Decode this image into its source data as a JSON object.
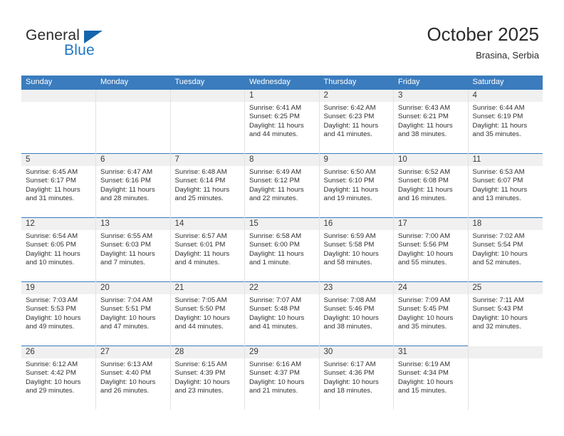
{
  "logo": {
    "word_top": "General",
    "word_bottom": "Blue",
    "triangle_color": "#1565ad",
    "blue_color": "#1f77c4"
  },
  "header": {
    "title": "October 2025",
    "subtitle": "Brasina, Serbia"
  },
  "theme": {
    "header_blue": "#3a7cbe",
    "daynum_band": "#f0f0f0",
    "cell_border": "#e2e2e2"
  },
  "weekdays": [
    "Sunday",
    "Monday",
    "Tuesday",
    "Wednesday",
    "Thursday",
    "Friday",
    "Saturday"
  ],
  "weeks": [
    [
      {
        "day": ""
      },
      {
        "day": ""
      },
      {
        "day": ""
      },
      {
        "day": "1",
        "sunrise": "Sunrise: 6:41 AM",
        "sunset": "Sunset: 6:25 PM",
        "daylight": "Daylight: 11 hours and 44 minutes."
      },
      {
        "day": "2",
        "sunrise": "Sunrise: 6:42 AM",
        "sunset": "Sunset: 6:23 PM",
        "daylight": "Daylight: 11 hours and 41 minutes."
      },
      {
        "day": "3",
        "sunrise": "Sunrise: 6:43 AM",
        "sunset": "Sunset: 6:21 PM",
        "daylight": "Daylight: 11 hours and 38 minutes."
      },
      {
        "day": "4",
        "sunrise": "Sunrise: 6:44 AM",
        "sunset": "Sunset: 6:19 PM",
        "daylight": "Daylight: 11 hours and 35 minutes."
      }
    ],
    [
      {
        "day": "5",
        "sunrise": "Sunrise: 6:45 AM",
        "sunset": "Sunset: 6:17 PM",
        "daylight": "Daylight: 11 hours and 31 minutes."
      },
      {
        "day": "6",
        "sunrise": "Sunrise: 6:47 AM",
        "sunset": "Sunset: 6:16 PM",
        "daylight": "Daylight: 11 hours and 28 minutes."
      },
      {
        "day": "7",
        "sunrise": "Sunrise: 6:48 AM",
        "sunset": "Sunset: 6:14 PM",
        "daylight": "Daylight: 11 hours and 25 minutes."
      },
      {
        "day": "8",
        "sunrise": "Sunrise: 6:49 AM",
        "sunset": "Sunset: 6:12 PM",
        "daylight": "Daylight: 11 hours and 22 minutes."
      },
      {
        "day": "9",
        "sunrise": "Sunrise: 6:50 AM",
        "sunset": "Sunset: 6:10 PM",
        "daylight": "Daylight: 11 hours and 19 minutes."
      },
      {
        "day": "10",
        "sunrise": "Sunrise: 6:52 AM",
        "sunset": "Sunset: 6:08 PM",
        "daylight": "Daylight: 11 hours and 16 minutes."
      },
      {
        "day": "11",
        "sunrise": "Sunrise: 6:53 AM",
        "sunset": "Sunset: 6:07 PM",
        "daylight": "Daylight: 11 hours and 13 minutes."
      }
    ],
    [
      {
        "day": "12",
        "sunrise": "Sunrise: 6:54 AM",
        "sunset": "Sunset: 6:05 PM",
        "daylight": "Daylight: 11 hours and 10 minutes."
      },
      {
        "day": "13",
        "sunrise": "Sunrise: 6:55 AM",
        "sunset": "Sunset: 6:03 PM",
        "daylight": "Daylight: 11 hours and 7 minutes."
      },
      {
        "day": "14",
        "sunrise": "Sunrise: 6:57 AM",
        "sunset": "Sunset: 6:01 PM",
        "daylight": "Daylight: 11 hours and 4 minutes."
      },
      {
        "day": "15",
        "sunrise": "Sunrise: 6:58 AM",
        "sunset": "Sunset: 6:00 PM",
        "daylight": "Daylight: 11 hours and 1 minute."
      },
      {
        "day": "16",
        "sunrise": "Sunrise: 6:59 AM",
        "sunset": "Sunset: 5:58 PM",
        "daylight": "Daylight: 10 hours and 58 minutes."
      },
      {
        "day": "17",
        "sunrise": "Sunrise: 7:00 AM",
        "sunset": "Sunset: 5:56 PM",
        "daylight": "Daylight: 10 hours and 55 minutes."
      },
      {
        "day": "18",
        "sunrise": "Sunrise: 7:02 AM",
        "sunset": "Sunset: 5:54 PM",
        "daylight": "Daylight: 10 hours and 52 minutes."
      }
    ],
    [
      {
        "day": "19",
        "sunrise": "Sunrise: 7:03 AM",
        "sunset": "Sunset: 5:53 PM",
        "daylight": "Daylight: 10 hours and 49 minutes."
      },
      {
        "day": "20",
        "sunrise": "Sunrise: 7:04 AM",
        "sunset": "Sunset: 5:51 PM",
        "daylight": "Daylight: 10 hours and 47 minutes."
      },
      {
        "day": "21",
        "sunrise": "Sunrise: 7:05 AM",
        "sunset": "Sunset: 5:50 PM",
        "daylight": "Daylight: 10 hours and 44 minutes."
      },
      {
        "day": "22",
        "sunrise": "Sunrise: 7:07 AM",
        "sunset": "Sunset: 5:48 PM",
        "daylight": "Daylight: 10 hours and 41 minutes."
      },
      {
        "day": "23",
        "sunrise": "Sunrise: 7:08 AM",
        "sunset": "Sunset: 5:46 PM",
        "daylight": "Daylight: 10 hours and 38 minutes."
      },
      {
        "day": "24",
        "sunrise": "Sunrise: 7:09 AM",
        "sunset": "Sunset: 5:45 PM",
        "daylight": "Daylight: 10 hours and 35 minutes."
      },
      {
        "day": "25",
        "sunrise": "Sunrise: 7:11 AM",
        "sunset": "Sunset: 5:43 PM",
        "daylight": "Daylight: 10 hours and 32 minutes."
      }
    ],
    [
      {
        "day": "26",
        "sunrise": "Sunrise: 6:12 AM",
        "sunset": "Sunset: 4:42 PM",
        "daylight": "Daylight: 10 hours and 29 minutes."
      },
      {
        "day": "27",
        "sunrise": "Sunrise: 6:13 AM",
        "sunset": "Sunset: 4:40 PM",
        "daylight": "Daylight: 10 hours and 26 minutes."
      },
      {
        "day": "28",
        "sunrise": "Sunrise: 6:15 AM",
        "sunset": "Sunset: 4:39 PM",
        "daylight": "Daylight: 10 hours and 23 minutes."
      },
      {
        "day": "29",
        "sunrise": "Sunrise: 6:16 AM",
        "sunset": "Sunset: 4:37 PM",
        "daylight": "Daylight: 10 hours and 21 minutes."
      },
      {
        "day": "30",
        "sunrise": "Sunrise: 6:17 AM",
        "sunset": "Sunset: 4:36 PM",
        "daylight": "Daylight: 10 hours and 18 minutes."
      },
      {
        "day": "31",
        "sunrise": "Sunrise: 6:19 AM",
        "sunset": "Sunset: 4:34 PM",
        "daylight": "Daylight: 10 hours and 15 minutes."
      },
      {
        "day": ""
      }
    ]
  ]
}
